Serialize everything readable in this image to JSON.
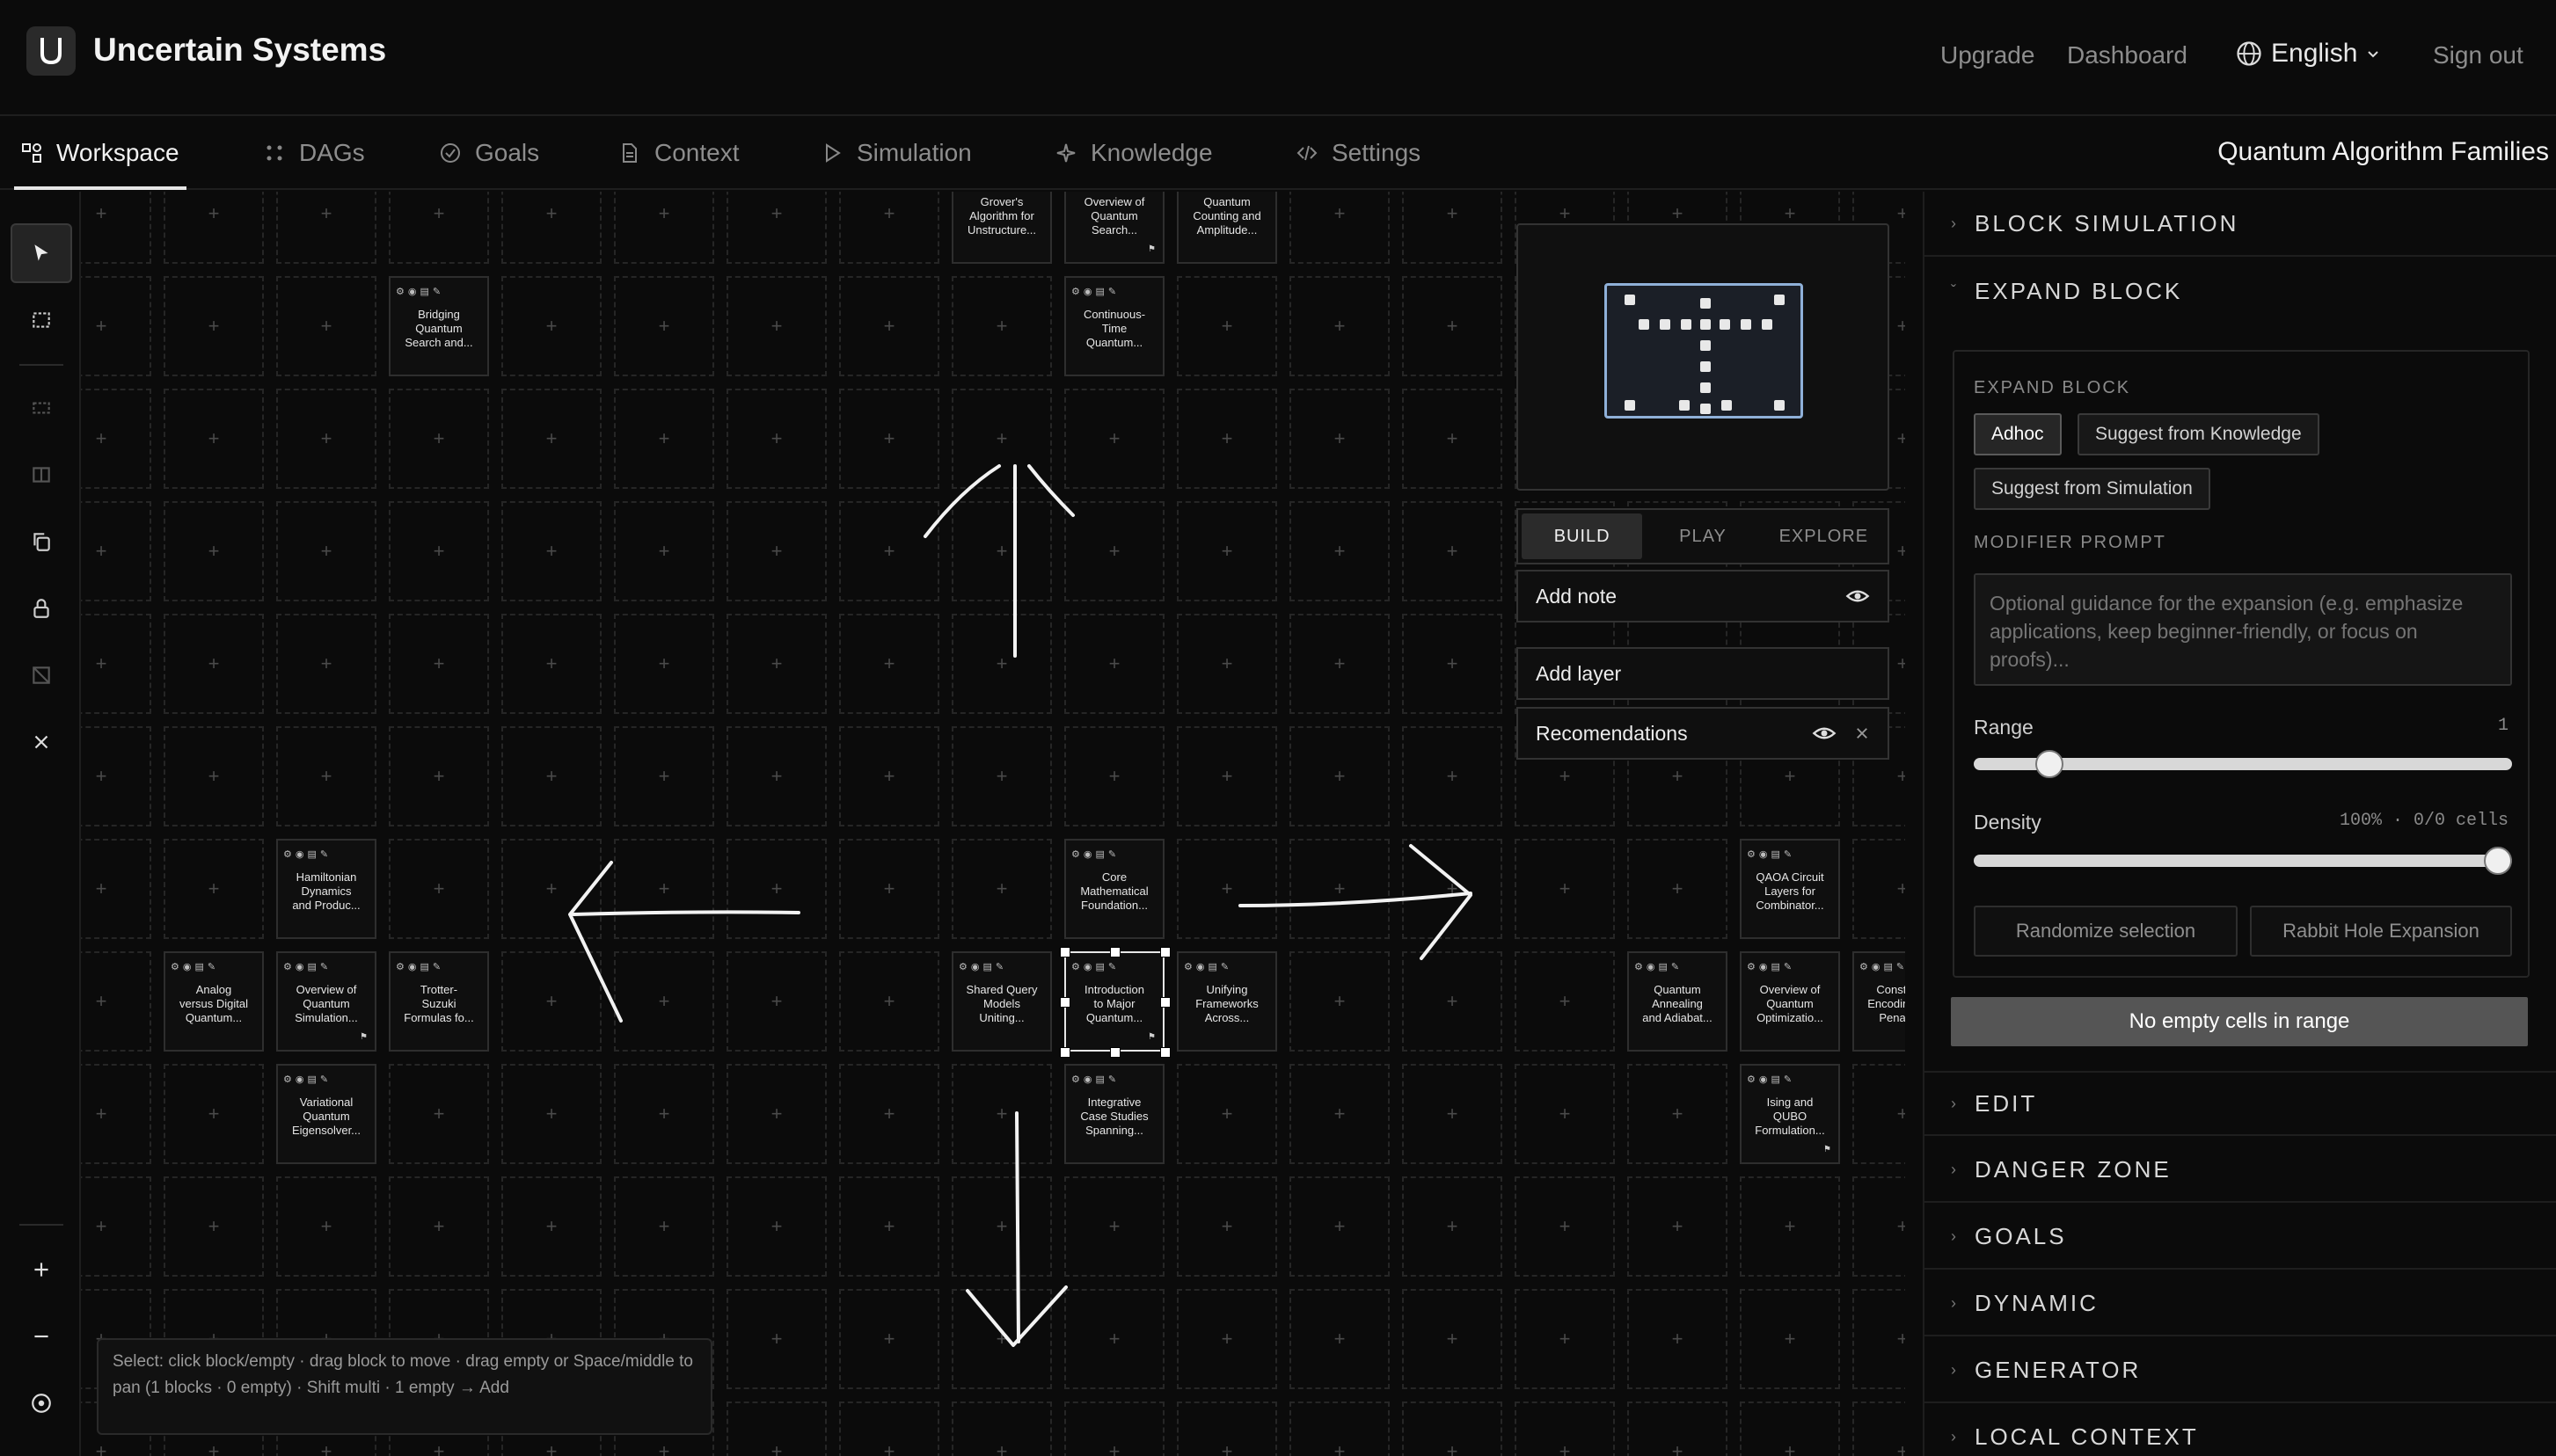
{
  "app": {
    "title": "Uncertain Systems"
  },
  "header": {
    "links": [
      "Upgrade",
      "Dashboard",
      "Sign out"
    ],
    "language": "English"
  },
  "tabs": [
    "Workspace",
    "DAGs",
    "Goals",
    "Context",
    "Simulation",
    "Knowledge",
    "Settings"
  ],
  "workspace_title": "Quantum Algorithm Families",
  "blocks": [
    {
      "id": "b1",
      "lines": [
        "Grover's",
        "Algorithm for",
        "Unstructure..."
      ]
    },
    {
      "id": "b2",
      "lines": [
        "Overview of",
        "Quantum",
        "Search..."
      ]
    },
    {
      "id": "b3",
      "lines": [
        "Quantum",
        "Counting and",
        "Amplitude..."
      ]
    },
    {
      "id": "b4",
      "lines": [
        "Bridging",
        "Quantum",
        "Search and..."
      ]
    },
    {
      "id": "b5",
      "lines": [
        "Continuous-",
        "Time",
        "Quantum..."
      ]
    },
    {
      "id": "b6",
      "lines": [
        "Hamiltonian",
        "Dynamics",
        "and Produc..."
      ]
    },
    {
      "id": "b7",
      "lines": [
        "Core",
        "Mathematical",
        "Foundation..."
      ]
    },
    {
      "id": "b8",
      "lines": [
        "QAOA Circuit",
        "Layers for",
        "Combinator..."
      ]
    },
    {
      "id": "b9",
      "lines": [
        "Analog",
        "versus Digital",
        "Quantum..."
      ]
    },
    {
      "id": "b10",
      "lines": [
        "Overview of",
        "Quantum",
        "Simulation..."
      ]
    },
    {
      "id": "b11",
      "lines": [
        "Trotter-",
        "Suzuki",
        "Formulas fo..."
      ]
    },
    {
      "id": "b12",
      "lines": [
        "Shared Query",
        "Models",
        "Uniting..."
      ]
    },
    {
      "id": "b13",
      "lines": [
        "Introduction",
        "to Major",
        "Quantum..."
      ]
    },
    {
      "id": "b14",
      "lines": [
        "Unifying",
        "Frameworks",
        "Across..."
      ]
    },
    {
      "id": "b15",
      "lines": [
        "Quantum",
        "Annealing",
        "and Adiabat..."
      ]
    },
    {
      "id": "b16",
      "lines": [
        "Overview of",
        "Quantum",
        "Optimizatio..."
      ]
    },
    {
      "id": "b17",
      "lines": [
        "Constraint",
        "Encoding and",
        "Penalty..."
      ]
    },
    {
      "id": "b18",
      "lines": [
        "Variational",
        "Quantum",
        "Eigensolver..."
      ]
    },
    {
      "id": "b19",
      "lines": [
        "Integrative",
        "Case Studies",
        "Spanning..."
      ]
    },
    {
      "id": "b20",
      "lines": [
        "Ising and",
        "QUBO",
        "Formulation..."
      ]
    }
  ],
  "status_text": "Select: click block/empty · drag block to move · drag empty or Space/middle to pan (1 blocks · 0 empty) · Shift multi · 1 empty → Add",
  "modes": [
    "BUILD",
    "PLAY",
    "EXPLORE"
  ],
  "canvas_panels": {
    "add_note": "Add note",
    "add_layer": "Add layer",
    "recommendations": "Recomendations"
  },
  "sidebar": {
    "sections_top": [
      "BLOCK SIMULATION",
      "EXPAND BLOCK"
    ],
    "expand": {
      "label": "EXPAND BLOCK",
      "sources": [
        "Adhoc",
        "Suggest from Knowledge",
        "Suggest from Simulation"
      ],
      "modifier_label": "MODIFIER PROMPT",
      "modifier_placeholder": "Optional guidance for the expansion (e.g. emphasize applications, keep beginner-friendly, or focus on proofs)...",
      "range_label": "Range",
      "range_value": "1",
      "range_fraction": 0.12,
      "density_label": "Density",
      "density_value": "100% · 0/0 cells",
      "density_fraction": 1.0,
      "randomize": "Randomize selection",
      "rabbit": "Rabbit Hole Expansion",
      "no_empty": "No empty cells in range"
    },
    "sections_bottom": [
      "EDIT",
      "DANGER ZONE",
      "GOALS",
      "DYNAMIC",
      "GENERATOR",
      "LOCAL CONTEXT"
    ]
  },
  "icons": {
    "block_toolbar": [
      "settings-icon",
      "eye-icon",
      "comment-icon",
      "edit-icon"
    ],
    "flag": "flag-icon",
    "empty_cell": "plus-icon"
  },
  "colors": {
    "background": "#0b0b0b",
    "minimap_view": "#8fb0d8"
  }
}
